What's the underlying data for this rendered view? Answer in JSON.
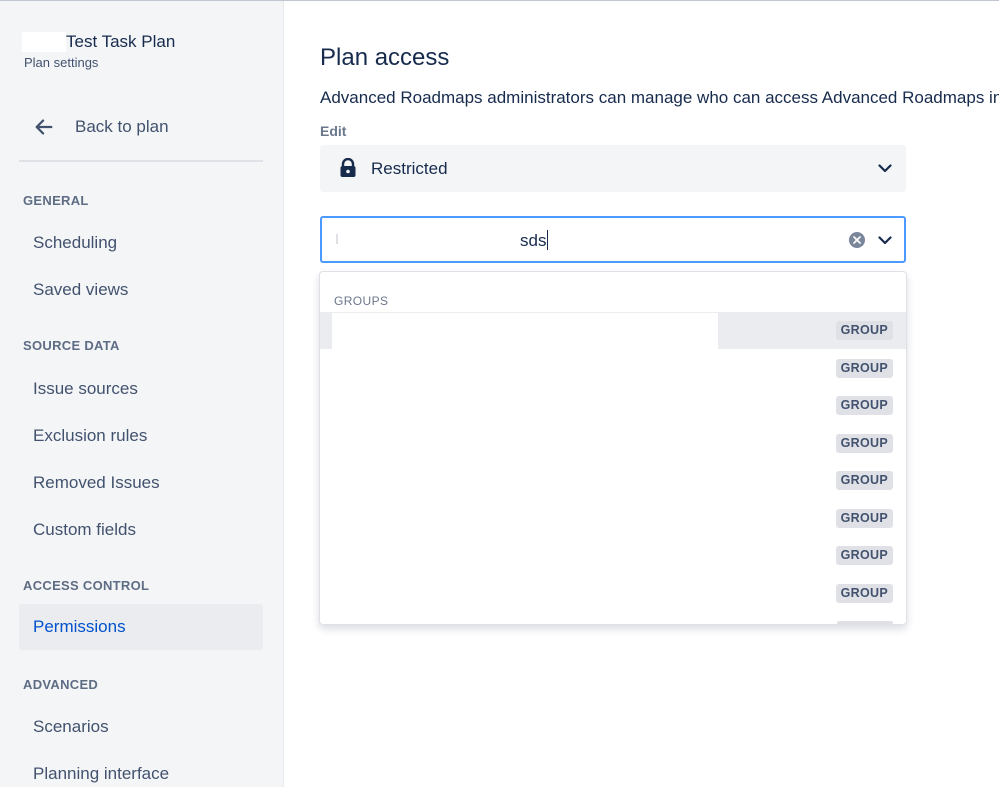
{
  "sidebar": {
    "plan_title": "Test Task Plan",
    "plan_subtitle": "Plan settings",
    "back_label": "Back to plan",
    "sections": {
      "general": "GENERAL",
      "source_data": "SOURCE DATA",
      "access_control": "ACCESS CONTROL",
      "advanced": "ADVANCED"
    },
    "items": {
      "scheduling": "Scheduling",
      "saved_views": "Saved views",
      "issue_sources": "Issue sources",
      "exclusion_rules": "Exclusion rules",
      "removed_issues": "Removed Issues",
      "custom_fields": "Custom fields",
      "permissions": "Permissions",
      "scenarios": "Scenarios",
      "planning_interface": "Planning interface"
    },
    "active_item": "permissions"
  },
  "main": {
    "title": "Plan access",
    "description": "Advanced Roadmaps administrators can manage who can access Advanced Roadmaps in",
    "edit_label": "Edit",
    "access_select": {
      "value": "Restricted",
      "icon": "lock-icon"
    },
    "search": {
      "value": "sds"
    },
    "dropdown": {
      "heading": "GROUPS",
      "options": [
        {
          "badge": "GROUP"
        },
        {
          "badge": "GROUP"
        },
        {
          "badge": "GROUP"
        },
        {
          "badge": "GROUP"
        },
        {
          "badge": "GROUP"
        },
        {
          "badge": "GROUP"
        },
        {
          "badge": "GROUP"
        },
        {
          "badge": "GROUP"
        }
      ]
    }
  },
  "colors": {
    "accent": "#0052cc",
    "focus_border": "#4c9aff",
    "sidebar_bg": "#f4f5f7",
    "badge_bg": "#dfe1e6"
  }
}
